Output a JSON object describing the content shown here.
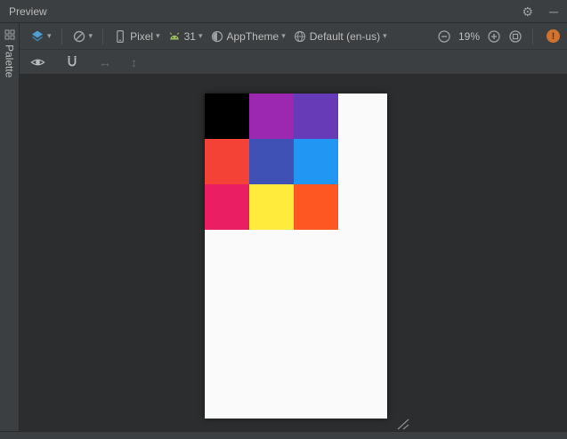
{
  "titlebar": {
    "title": "Preview"
  },
  "glyphs": {
    "gear": "⚙",
    "minimize": "─",
    "dropdown": "▾",
    "h_arrows": "↔",
    "v_arrows": "↕",
    "error_mark": "!"
  },
  "toolbar": {
    "device": {
      "label": "Pixel"
    },
    "api": {
      "label": "31"
    },
    "theme": {
      "label": "AppTheme"
    },
    "locale": {
      "label": "Default (en-us)"
    },
    "zoom": {
      "level": "19%"
    }
  },
  "sidebar": {
    "palette_label": "Palette"
  },
  "artboard": {
    "background": "#FAFAFA",
    "swatch_grid": {
      "rows": 3,
      "cols": 3,
      "colors": [
        [
          "#000000",
          "#9C27B0",
          "#673AB7"
        ],
        [
          "#F44336",
          "#3F51B5",
          "#2196F3"
        ],
        [
          "#E91E63",
          "#FFEB3B",
          "#FF5722"
        ]
      ]
    }
  },
  "colors": {
    "titlebar_bg": "#3C3F41",
    "canvas_bg": "#2B2D2E",
    "layers_icon_blue": "#4E9FD4",
    "android_green": "#9BC15C",
    "error_badge": "#D0732F",
    "text": "#BBBBBB"
  }
}
